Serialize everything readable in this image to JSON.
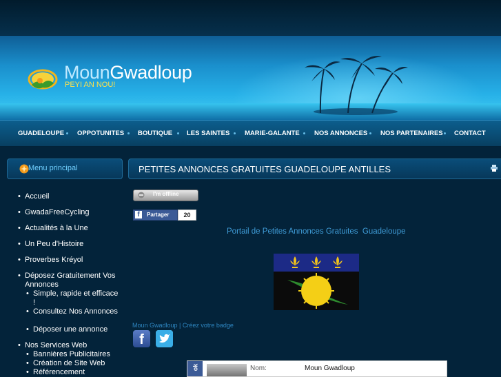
{
  "header": {
    "title_part1": "Moun",
    "title_part2": "Gwadloup",
    "tagline": "PEYI AN NOU!"
  },
  "nav": {
    "items": [
      "GUADELOUPE",
      "OPPOTUNITES",
      "BOUTIQUE",
      "LES SAINTES",
      "MARIE-GALANTE",
      "NOS ANNONCES",
      "NOS PARTENAIRES",
      "CONTACT"
    ]
  },
  "sidebar": {
    "title": "Menu principal",
    "items": [
      "Accueil",
      "GwadaFreeCycling",
      "Actualités à la Une",
      "Un Peu d'Histoire",
      "Proverbes Kréyol",
      "Déposez Gratuitement Vos Annonces",
      "Nos Services Web"
    ],
    "annonces_sub": [
      "Simple, rapide et efficace !",
      "Consultez Nos Annonces",
      "Déposer une annonce"
    ],
    "services_sub": [
      "Bannières Publicitaires",
      "Création de Site Web",
      "Référencement"
    ]
  },
  "content": {
    "title": "PETITES ANNONCES GRATUITES GUADELOUPE ANTILLES",
    "offline_label": "I'm offline",
    "share_label": "Partager",
    "share_count": "20",
    "portal_text": "Portail de Petites Annonces Gratuites  Guadeloupe",
    "badge_link": "Moun Gwadloup | Créez votre badge",
    "facebook_glyph": "f",
    "profile": {
      "side_label": "ok",
      "key": "Nom:",
      "value": "Moun Gwadloup"
    }
  },
  "colors": {
    "background": "#03233a",
    "nav": "#0a4f78",
    "link": "#3f9bd6",
    "tagline": "#ffe24a",
    "flag_blue": "#1c2a86",
    "flag_lily": "#f2c31b",
    "flag_sun": "#f4cf16",
    "flag_cane": "#2e8b2e"
  },
  "icons": {
    "logo": "sun-logo-icon",
    "sidebar": "flower-icon",
    "print": "print-icon",
    "offline": "offline-icon",
    "facebook": "facebook-icon",
    "twitter": "twitter-icon"
  }
}
